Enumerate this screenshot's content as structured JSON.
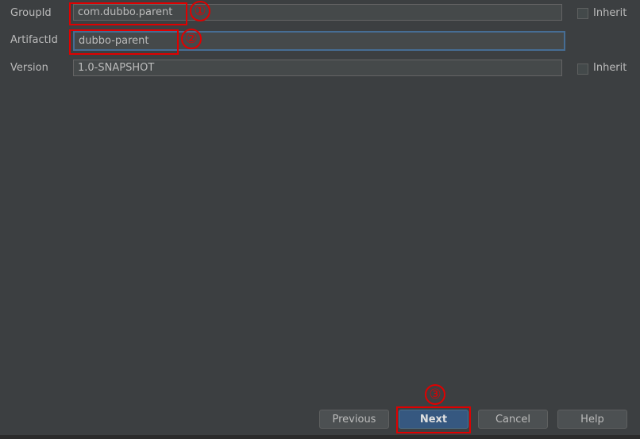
{
  "form": {
    "group_id": {
      "label": "GroupId",
      "value": "com.dubbo.parent",
      "inherit_label": "Inherit",
      "inherit_checked": false
    },
    "artifact_id": {
      "label": "ArtifactId",
      "value": "dubbo-parent"
    },
    "version": {
      "label": "Version",
      "value": "1.0-SNAPSHOT",
      "inherit_label": "Inherit",
      "inherit_checked": false
    }
  },
  "buttons": {
    "previous": "Previous",
    "next": "Next",
    "cancel": "Cancel",
    "help": "Help"
  },
  "annotations": [
    "①",
    "②",
    "③"
  ],
  "colors": {
    "annotation": "#e00000",
    "default_button": "#365880",
    "focus_border": "#466d94"
  }
}
